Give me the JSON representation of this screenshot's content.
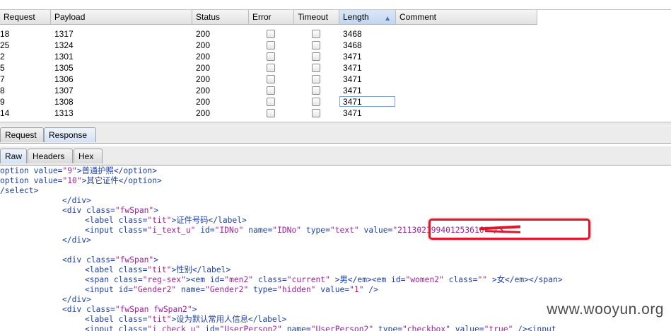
{
  "table": {
    "columns": [
      "Request",
      "Payload",
      "Status",
      "Error",
      "Timeout",
      "Length",
      "Comment"
    ],
    "sorted_column": "Length",
    "rows": [
      {
        "request": "18",
        "payload": "1317",
        "status": "200",
        "length": "3468"
      },
      {
        "request": "25",
        "payload": "1324",
        "status": "200",
        "length": "3468"
      },
      {
        "request": "2",
        "payload": "1301",
        "status": "200",
        "length": "3471"
      },
      {
        "request": "5",
        "payload": "1305",
        "status": "200",
        "length": "3471"
      },
      {
        "request": "7",
        "payload": "1306",
        "status": "200",
        "length": "3471"
      },
      {
        "request": "8",
        "payload": "1307",
        "status": "200",
        "length": "3471"
      },
      {
        "request": "9",
        "payload": "1308",
        "status": "200",
        "length": "3471"
      },
      {
        "request": "14",
        "payload": "1313",
        "status": "200",
        "length": "3471"
      }
    ]
  },
  "tabs_top": {
    "request": "Request",
    "response": "Response",
    "active": "Response"
  },
  "tabs_view": {
    "raw": "Raw",
    "headers": "Headers",
    "hex": "Hex",
    "active": "Raw"
  },
  "code": {
    "l1_a": "option ",
    "l1_b": "value=",
    "l1_c": "\"9\"",
    "l1_d": ">普通护照</",
    "l1_e": "option",
    "l1_f": ">",
    "l2_a": "option ",
    "l2_b": "value=",
    "l2_c": "\"10\"",
    "l2_d": ">其它证件</",
    "l2_e": "option",
    "l2_f": ">",
    "l3": "/select>",
    "l4": "</div>",
    "l5_a": "<div ",
    "l5_b": "class=",
    "l5_c": "\"fwSpan\"",
    "l5_d": ">",
    "l6_a": "<label ",
    "l6_b": "class=",
    "l6_c": "\"tit\"",
    "l6_d": ">证件号码</",
    "l6_e": "label",
    "l6_f": ">",
    "l7_a": "<input ",
    "l7_b": "class=",
    "l7_c": "\"i_text_u\"",
    "l7_d": " id=",
    "l7_e": "\"IDNo\"",
    "l7_f": " name=",
    "l7_g": "\"IDNo\"",
    "l7_h": " type=",
    "l7_i": "\"text\"",
    "l7_j": " value=",
    "l7_k": "\"211302199401253616\"",
    "l7_l": " />",
    "l8": "</div>",
    "l9_a": "<div ",
    "l9_b": "class=",
    "l9_c": "\"fwSpan\"",
    "l9_d": ">",
    "l10_a": "<label ",
    "l10_b": "class=",
    "l10_c": "\"tit\"",
    "l10_d": ">性别</",
    "l10_e": "label",
    "l10_f": ">",
    "l11_a": "<span ",
    "l11_b": "class=",
    "l11_c": "\"reg-sex\"",
    "l11_d": "><",
    "l11_e": "em ",
    "l11_f": "id=",
    "l11_g": "\"men2\"",
    "l11_h": " class=",
    "l11_i": "\"current\"",
    "l11_j": " >男</",
    "l11_k": "em",
    "l11_l": "><",
    "l11_m": "em ",
    "l11_n": "id=",
    "l11_o": "\"women2\"",
    "l11_p": " class=",
    "l11_q": "\"\"",
    "l11_r": " >女</",
    "l11_s": "em",
    "l11_t": "></",
    "l11_u": "span",
    "l11_v": ">",
    "l12_a": "<input ",
    "l12_b": "id=",
    "l12_c": "\"Gender2\"",
    "l12_d": " name=",
    "l12_e": "\"Gender2\"",
    "l12_f": " type=",
    "l12_g": "\"hidden\"",
    "l12_h": " value=",
    "l12_i": "\"1\"",
    "l12_j": " />",
    "l13": "</div>",
    "l14_a": "<div ",
    "l14_b": "class=",
    "l14_c": "\"fwSpan fwSpan2\"",
    "l14_d": ">",
    "l15_a": "<label ",
    "l15_b": "class=",
    "l15_c": "\"tit\"",
    "l15_d": ">设为默认常用人信息</",
    "l15_e": "label",
    "l15_f": ">",
    "l16_a": "<input ",
    "l16_b": "class=",
    "l16_c": "\"i_check_u\"",
    "l16_d": " id=",
    "l16_e": "\"UserPerson2\"",
    "l16_f": " name=",
    "l16_g": "\"UserPerson2\"",
    "l16_h": " type=",
    "l16_i": "\"checkbox\"",
    "l16_j": " value=",
    "l16_k": "\"true\"",
    "l16_l": " /><",
    "l16_m": "input"
  },
  "watermark": "www.wooyun.org",
  "colors": {
    "tag": "#1d3fa8",
    "value": "#a0209c",
    "highlight": "#e0162a"
  }
}
